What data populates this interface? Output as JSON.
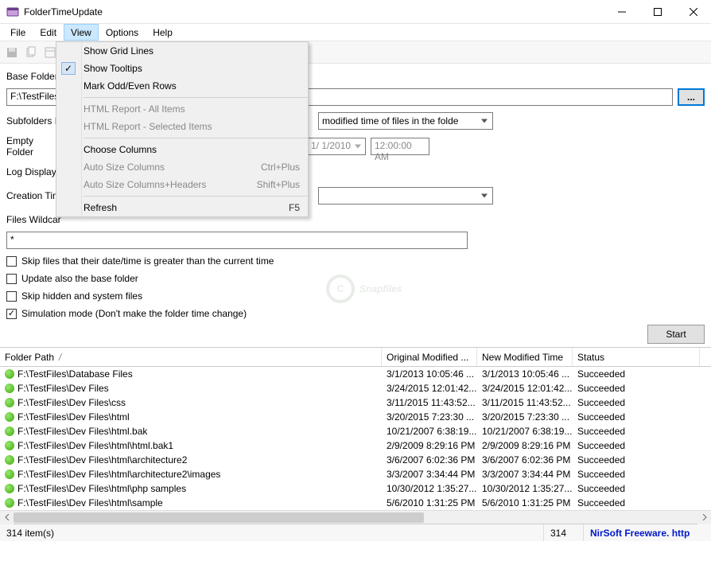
{
  "window": {
    "title": "FolderTimeUpdate"
  },
  "menubar": {
    "items": [
      "File",
      "Edit",
      "View",
      "Options",
      "Help"
    ],
    "active": "View"
  },
  "view_menu": {
    "items": [
      {
        "label": "Show Grid Lines",
        "checked": false,
        "enabled": true
      },
      {
        "label": "Show Tooltips",
        "checked": true,
        "enabled": true
      },
      {
        "label": "Mark Odd/Even Rows",
        "checked": false,
        "enabled": true
      }
    ],
    "items2": [
      {
        "label": "HTML Report - All Items",
        "enabled": false
      },
      {
        "label": "HTML Report - Selected Items",
        "enabled": false
      }
    ],
    "items3": [
      {
        "label": "Choose Columns",
        "enabled": true
      },
      {
        "label": "Auto Size Columns",
        "enabled": false,
        "shortcut": "Ctrl+Plus"
      },
      {
        "label": "Auto Size Columns+Headers",
        "enabled": false,
        "shortcut": "Shift+Plus"
      }
    ],
    "items4": [
      {
        "label": "Refresh",
        "enabled": true,
        "shortcut": "F5"
      }
    ]
  },
  "form": {
    "base_folder_label": "Base Folder:",
    "base_folder_value": "F:\\TestFiles",
    "browse": "...",
    "subfolders_label": "Subfolders D",
    "subfolders_dd_text": "modified time of files in the folde",
    "empty_folders_label": "Empty Folder",
    "date_value": "1/ 1/2010",
    "time_value": "12:00:00 AM",
    "log_display_label": "Log Display:",
    "creation_time_label": "Creation Tim",
    "wildcard_label": "Files Wildcar",
    "wildcard_value": "*",
    "chk_skip_future": "Skip files that their date/time is greater than the current time",
    "chk_update_base": "Update also the base folder",
    "chk_skip_hidden": "Skip hidden and system files",
    "chk_simulation": "Simulation mode (Don't make the folder time change)",
    "start": "Start"
  },
  "grid": {
    "headers": [
      "Folder Path",
      "Original Modified ...",
      "New Modified Time",
      "Status"
    ],
    "sort_indicator": "/",
    "rows": [
      {
        "path": "F:\\TestFiles\\Database Files",
        "orig": "3/1/2013 10:05:46 ...",
        "new": "3/1/2013 10:05:46 ...",
        "status": "Succeeded"
      },
      {
        "path": "F:\\TestFiles\\Dev Files",
        "orig": "3/24/2015 12:01:42...",
        "new": "3/24/2015 12:01:42...",
        "status": "Succeeded"
      },
      {
        "path": "F:\\TestFiles\\Dev Files\\css",
        "orig": "3/11/2015 11:43:52...",
        "new": "3/11/2015 11:43:52...",
        "status": "Succeeded"
      },
      {
        "path": "F:\\TestFiles\\Dev Files\\html",
        "orig": "3/20/2015 7:23:30 ...",
        "new": "3/20/2015 7:23:30 ...",
        "status": "Succeeded"
      },
      {
        "path": "F:\\TestFiles\\Dev Files\\html.bak",
        "orig": "10/21/2007 6:38:19...",
        "new": "10/21/2007 6:38:19...",
        "status": "Succeeded"
      },
      {
        "path": "F:\\TestFiles\\Dev Files\\html\\html.bak1",
        "orig": "2/9/2009 8:29:16 PM",
        "new": "2/9/2009 8:29:16 PM",
        "status": "Succeeded"
      },
      {
        "path": "F:\\TestFiles\\Dev Files\\html\\architecture2",
        "orig": "3/6/2007 6:02:36 PM",
        "new": "3/6/2007 6:02:36 PM",
        "status": "Succeeded"
      },
      {
        "path": "F:\\TestFiles\\Dev Files\\html\\architecture2\\images",
        "orig": "3/3/2007 3:34:44 PM",
        "new": "3/3/2007 3:34:44 PM",
        "status": "Succeeded"
      },
      {
        "path": "F:\\TestFiles\\Dev Files\\html\\php samples",
        "orig": "10/30/2012 1:35:27...",
        "new": "10/30/2012 1:35:27...",
        "status": "Succeeded"
      },
      {
        "path": "F:\\TestFiles\\Dev Files\\html\\sample",
        "orig": "5/6/2010 1:31:25 PM",
        "new": "5/6/2010 1:31:25 PM",
        "status": "Succeeded"
      }
    ]
  },
  "statusbar": {
    "left": "314 item(s)",
    "count": "314",
    "link": "NirSoft Freeware.  http"
  },
  "watermark": {
    "c": "C",
    "text": "Snapfiles"
  }
}
